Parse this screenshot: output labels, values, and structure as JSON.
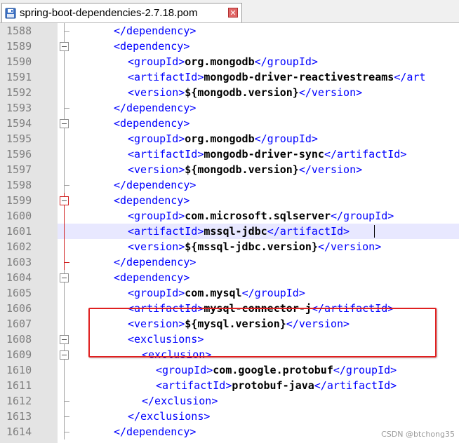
{
  "tab": {
    "title": "spring-boot-dependencies-2.7.18.pom",
    "close_glyph": "✕",
    "icon": "floppy-disk-icon"
  },
  "lines": [
    {
      "num": "1588",
      "indent": 2,
      "parts": [
        {
          "t": "tag",
          "s": "</dependency>"
        }
      ]
    },
    {
      "num": "1589",
      "indent": 2,
      "parts": [
        {
          "t": "tag",
          "s": "<dependency>"
        }
      ]
    },
    {
      "num": "1590",
      "indent": 3,
      "parts": [
        {
          "t": "tag",
          "s": "<groupId>"
        },
        {
          "t": "txt",
          "s": "org.mongodb"
        },
        {
          "t": "tag",
          "s": "</groupId>"
        }
      ]
    },
    {
      "num": "1591",
      "indent": 3,
      "parts": [
        {
          "t": "tag",
          "s": "<artifactId>"
        },
        {
          "t": "txt",
          "s": "mongodb-driver-reactivestreams"
        },
        {
          "t": "tag",
          "s": "</art"
        }
      ]
    },
    {
      "num": "1592",
      "indent": 3,
      "parts": [
        {
          "t": "tag",
          "s": "<version>"
        },
        {
          "t": "txt",
          "s": "${mongodb.version}"
        },
        {
          "t": "tag",
          "s": "</version>"
        }
      ]
    },
    {
      "num": "1593",
      "indent": 2,
      "parts": [
        {
          "t": "tag",
          "s": "</dependency>"
        }
      ]
    },
    {
      "num": "1594",
      "indent": 2,
      "parts": [
        {
          "t": "tag",
          "s": "<dependency>"
        }
      ]
    },
    {
      "num": "1595",
      "indent": 3,
      "parts": [
        {
          "t": "tag",
          "s": "<groupId>"
        },
        {
          "t": "txt",
          "s": "org.mongodb"
        },
        {
          "t": "tag",
          "s": "</groupId>"
        }
      ]
    },
    {
      "num": "1596",
      "indent": 3,
      "parts": [
        {
          "t": "tag",
          "s": "<artifactId>"
        },
        {
          "t": "txt",
          "s": "mongodb-driver-sync"
        },
        {
          "t": "tag",
          "s": "</artifactId>"
        }
      ]
    },
    {
      "num": "1597",
      "indent": 3,
      "parts": [
        {
          "t": "tag",
          "s": "<version>"
        },
        {
          "t": "txt",
          "s": "${mongodb.version}"
        },
        {
          "t": "tag",
          "s": "</version>"
        }
      ]
    },
    {
      "num": "1598",
      "indent": 2,
      "parts": [
        {
          "t": "tag",
          "s": "</dependency>"
        }
      ]
    },
    {
      "num": "1599",
      "indent": 2,
      "parts": [
        {
          "t": "tag",
          "s": "<dependency>"
        }
      ]
    },
    {
      "num": "1600",
      "indent": 3,
      "parts": [
        {
          "t": "tag",
          "s": "<groupId>"
        },
        {
          "t": "txt",
          "s": "com.microsoft.sqlserver"
        },
        {
          "t": "tag",
          "s": "</groupId>"
        }
      ]
    },
    {
      "num": "1601",
      "indent": 3,
      "parts": [
        {
          "t": "tag",
          "s": "<artifactId>"
        },
        {
          "t": "txt",
          "s": "mssql-jdbc"
        },
        {
          "t": "tag",
          "s": "</artifactId>"
        }
      ]
    },
    {
      "num": "1602",
      "indent": 3,
      "parts": [
        {
          "t": "tag",
          "s": "<version>"
        },
        {
          "t": "txt",
          "s": "${mssql-jdbc.version}"
        },
        {
          "t": "tag",
          "s": "</version>"
        }
      ]
    },
    {
      "num": "1603",
      "indent": 2,
      "parts": [
        {
          "t": "tag",
          "s": "</dependency>"
        }
      ]
    },
    {
      "num": "1604",
      "indent": 2,
      "parts": [
        {
          "t": "tag",
          "s": "<dependency>"
        }
      ]
    },
    {
      "num": "1605",
      "indent": 3,
      "parts": [
        {
          "t": "tag",
          "s": "<groupId>"
        },
        {
          "t": "txt",
          "s": "com.mysql"
        },
        {
          "t": "tag",
          "s": "</groupId>"
        }
      ]
    },
    {
      "num": "1606",
      "indent": 3,
      "parts": [
        {
          "t": "tag",
          "s": "<artifactId>"
        },
        {
          "t": "txt",
          "s": "mysql-connector-j"
        },
        {
          "t": "tag",
          "s": "</artifactId>"
        }
      ]
    },
    {
      "num": "1607",
      "indent": 3,
      "parts": [
        {
          "t": "tag",
          "s": "<version>"
        },
        {
          "t": "txt",
          "s": "${mysql.version}"
        },
        {
          "t": "tag",
          "s": "</version>"
        }
      ]
    },
    {
      "num": "1608",
      "indent": 3,
      "parts": [
        {
          "t": "tag",
          "s": "<exclusions>"
        }
      ]
    },
    {
      "num": "1609",
      "indent": 4,
      "parts": [
        {
          "t": "tag",
          "s": "<exclusion>"
        }
      ]
    },
    {
      "num": "1610",
      "indent": 5,
      "parts": [
        {
          "t": "tag",
          "s": "<groupId>"
        },
        {
          "t": "txt",
          "s": "com.google.protobuf"
        },
        {
          "t": "tag",
          "s": "</groupId>"
        }
      ]
    },
    {
      "num": "1611",
      "indent": 5,
      "parts": [
        {
          "t": "tag",
          "s": "<artifactId>"
        },
        {
          "t": "txt",
          "s": "protobuf-java"
        },
        {
          "t": "tag",
          "s": "</artifactId>"
        }
      ]
    },
    {
      "num": "1612",
      "indent": 4,
      "parts": [
        {
          "t": "tag",
          "s": "</exclusion>"
        }
      ]
    },
    {
      "num": "1613",
      "indent": 3,
      "parts": [
        {
          "t": "tag",
          "s": "</exclusions>"
        }
      ]
    },
    {
      "num": "1614",
      "indent": 2,
      "parts": [
        {
          "t": "tag",
          "s": "</dependency>"
        }
      ]
    }
  ],
  "watermark": "CSDN @btchong35",
  "colors": {
    "tag": "#0000ff",
    "text": "#000000",
    "highlight_box": "#e02020"
  }
}
